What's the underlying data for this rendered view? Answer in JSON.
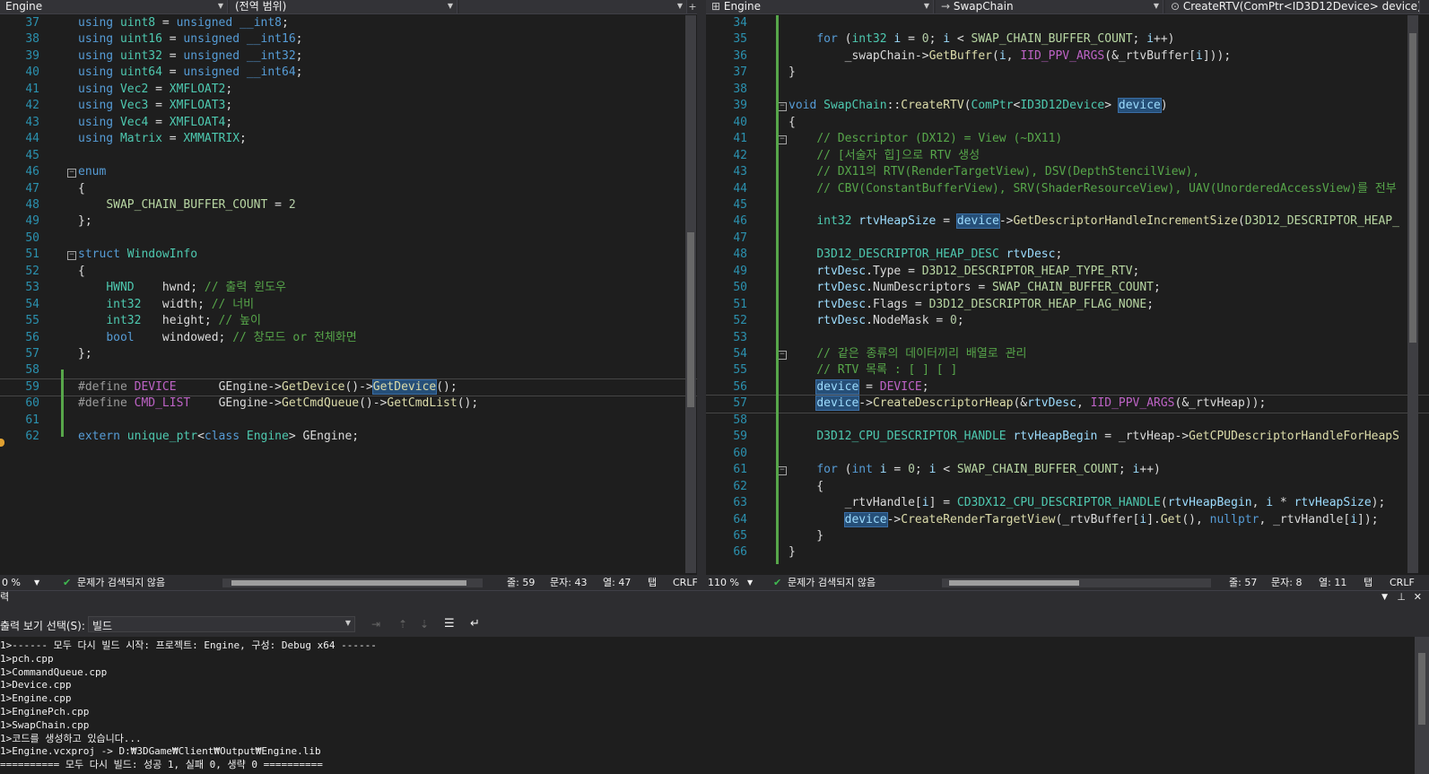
{
  "left_editor": {
    "nav": {
      "project": "Engine",
      "scope": "(전역 범위)",
      "member": ""
    },
    "status": {
      "zoom": "0 %",
      "issues": "문제가 검색되지 않음",
      "line": "줄: 59",
      "char": "문자: 43",
      "col": "열: 47",
      "tab": "탭",
      "eol": "CRLF"
    },
    "lines": [
      {
        "n": "37",
        "html": "<span class='kw'>using</span> <span class='ty'>uint8</span> = <span class='kw'>unsigned</span> <span class='kw'>__int8</span>;"
      },
      {
        "n": "38",
        "html": "<span class='kw'>using</span> <span class='ty'>uint16</span> = <span class='kw'>unsigned</span> <span class='kw'>__int16</span>;"
      },
      {
        "n": "39",
        "html": "<span class='kw'>using</span> <span class='ty'>uint32</span> = <span class='kw'>unsigned</span> <span class='kw'>__int32</span>;"
      },
      {
        "n": "40",
        "html": "<span class='kw'>using</span> <span class='ty'>uint64</span> = <span class='kw'>unsigned</span> <span class='kw'>__int64</span>;"
      },
      {
        "n": "41",
        "html": "<span class='kw'>using</span> <span class='ty'>Vec2</span> = <span class='ty'>XMFLOAT2</span>;"
      },
      {
        "n": "42",
        "html": "<span class='kw'>using</span> <span class='ty'>Vec3</span> = <span class='ty'>XMFLOAT3</span>;"
      },
      {
        "n": "43",
        "html": "<span class='kw'>using</span> <span class='ty'>Vec4</span> = <span class='ty'>XMFLOAT4</span>;"
      },
      {
        "n": "44",
        "html": "<span class='kw'>using</span> <span class='ty'>Matrix</span> = <span class='ty'>XMMATRIX</span>;"
      },
      {
        "n": "45",
        "html": ""
      },
      {
        "n": "46",
        "html": "<span class='kw'>enum</span>"
      },
      {
        "n": "47",
        "html": "{"
      },
      {
        "n": "48",
        "html": "    <span class='en'>SWAP_CHAIN_BUFFER_COUNT</span> = <span class='nm'>2</span>"
      },
      {
        "n": "49",
        "html": "};"
      },
      {
        "n": "50",
        "html": ""
      },
      {
        "n": "51",
        "html": "<span class='kw'>struct</span> <span class='ty'>WindowInfo</span>"
      },
      {
        "n": "52",
        "html": "{"
      },
      {
        "n": "53",
        "html": "    <span class='ty'>HWND</span>    hwnd; <span class='cm'>// 출력 윈도우</span>"
      },
      {
        "n": "54",
        "html": "    <span class='ty'>int32</span>   width; <span class='cm'>// 너비</span>"
      },
      {
        "n": "55",
        "html": "    <span class='ty'>int32</span>   height; <span class='cm'>// 높이</span>"
      },
      {
        "n": "56",
        "html": "    <span class='kw'>bool</span>    windowed; <span class='cm'>// 창모드 or 전체화면</span>"
      },
      {
        "n": "57",
        "html": "};"
      },
      {
        "n": "58",
        "html": ""
      },
      {
        "n": "59",
        "html": "<span class='pp'>#define</span> <span class='mc'>DEVICE</span>      <span class='mem'>GEngine</span>-><span class='fn'>GetDevice</span>()-><span class='fn hl'>GetDevice</span>();"
      },
      {
        "n": "60",
        "html": "<span class='pp'>#define</span> <span class='mc'>CMD_LIST</span>    <span class='mem'>GEngine</span>-><span class='fn'>GetCmdQueue</span>()-><span class='fn'>GetCmdList</span>();"
      },
      {
        "n": "61",
        "html": ""
      },
      {
        "n": "62",
        "html": "<span class='kw'>extern</span> <span class='ty'>unique_ptr</span>&lt;<span class='kw'>class</span> <span class='ty'>Engine</span>&gt; <span class='mem'>GEngine</span>;"
      }
    ]
  },
  "right_editor": {
    "nav": {
      "project": "Engine",
      "scope": "SwapChain",
      "member": "CreateRTV(ComPtr<ID3D12Device> device)"
    },
    "status": {
      "zoom": "110 %",
      "issues": "문제가 검색되지 않음",
      "line": "줄: 57",
      "char": "문자: 8",
      "col": "열: 11",
      "tab": "탭",
      "eol": "CRLF"
    },
    "lines": [
      {
        "n": "34",
        "html": ""
      },
      {
        "n": "35",
        "html": "    <span class='kw'>for</span> (<span class='ty'>int32</span> <span class='var'>i</span> = <span class='nm'>0</span>; <span class='var'>i</span> &lt; <span class='en'>SWAP_CHAIN_BUFFER_COUNT</span>; <span class='var'>i</span>++)"
      },
      {
        "n": "36",
        "html": "        <span class='mem'>_swapChain</span>-><span class='fn'>GetBuffer</span>(<span class='var'>i</span>, <span class='mc'>IID_PPV_ARGS</span>(&amp;<span class='mem'>_rtvBuffer</span>[<span class='var'>i</span>]));"
      },
      {
        "n": "37",
        "html": "}"
      },
      {
        "n": "38",
        "html": ""
      },
      {
        "n": "39",
        "html": "<span class='kw'>void</span> <span class='ty'>SwapChain</span>::<span class='fn'>CreateRTV</span>(<span class='ty'>ComPtr</span>&lt;<span class='ty'>ID3D12Device</span>&gt; <span class='var hl'>device</span>)"
      },
      {
        "n": "40",
        "html": "{"
      },
      {
        "n": "41",
        "html": "    <span class='cm'>// Descriptor (DX12) = View (~DX11)</span>"
      },
      {
        "n": "42",
        "html": "    <span class='cm'>// [서술자 힙]으로 RTV 생성</span>"
      },
      {
        "n": "43",
        "html": "    <span class='cm'>// DX11의 RTV(RenderTargetView), DSV(DepthStencilView),</span>"
      },
      {
        "n": "44",
        "html": "    <span class='cm'>// CBV(ConstantBufferView), SRV(ShaderResourceView), UAV(UnorderedAccessView)를 전부</span>"
      },
      {
        "n": "45",
        "html": ""
      },
      {
        "n": "46",
        "html": "    <span class='ty'>int32</span> <span class='var'>rtvHeapSize</span> = <span class='var hl'>device</span>-><span class='fn'>GetDescriptorHandleIncrementSize</span>(<span class='en'>D3D12_DESCRIPTOR_HEAP_</span>"
      },
      {
        "n": "47",
        "html": ""
      },
      {
        "n": "48",
        "html": "    <span class='ty'>D3D12_DESCRIPTOR_HEAP_DESC</span> <span class='var'>rtvDesc</span>;"
      },
      {
        "n": "49",
        "html": "    <span class='var'>rtvDesc</span>.<span class='mem'>Type</span> = <span class='en'>D3D12_DESCRIPTOR_HEAP_TYPE_RTV</span>;"
      },
      {
        "n": "50",
        "html": "    <span class='var'>rtvDesc</span>.<span class='mem'>NumDescriptors</span> = <span class='en'>SWAP_CHAIN_BUFFER_COUNT</span>;"
      },
      {
        "n": "51",
        "html": "    <span class='var'>rtvDesc</span>.<span class='mem'>Flags</span> = <span class='en'>D3D12_DESCRIPTOR_HEAP_FLAG_NONE</span>;"
      },
      {
        "n": "52",
        "html": "    <span class='var'>rtvDesc</span>.<span class='mem'>NodeMask</span> = <span class='nm'>0</span>;"
      },
      {
        "n": "53",
        "html": ""
      },
      {
        "n": "54",
        "html": "    <span class='cm'>// 같은 종류의 데이터끼리 배열로 관리</span>"
      },
      {
        "n": "55",
        "html": "    <span class='cm'>// RTV 목록 : [ ] [ ]</span>"
      },
      {
        "n": "56",
        "html": "    <span class='var hl'>device</span> = <span class='mc'>DEVICE</span>;"
      },
      {
        "n": "57",
        "html": "    <span class='var hl'>device</span>-><span class='fn'>CreateDescriptorHeap</span>(&amp;<span class='var'>rtvDesc</span>, <span class='mc'>IID_PPV_ARGS</span>(&amp;<span class='mem'>_rtvHeap</span>));"
      },
      {
        "n": "58",
        "html": ""
      },
      {
        "n": "59",
        "html": "    <span class='ty'>D3D12_CPU_DESCRIPTOR_HANDLE</span> <span class='var'>rtvHeapBegin</span> = <span class='mem'>_rtvHeap</span>-><span class='fn'>GetCPUDescriptorHandleForHeapS</span>"
      },
      {
        "n": "60",
        "html": ""
      },
      {
        "n": "61",
        "html": "    <span class='kw'>for</span> (<span class='kw'>int</span> <span class='var'>i</span> = <span class='nm'>0</span>; <span class='var'>i</span> &lt; <span class='en'>SWAP_CHAIN_BUFFER_COUNT</span>; <span class='var'>i</span>++)"
      },
      {
        "n": "62",
        "html": "    {"
      },
      {
        "n": "63",
        "html": "        <span class='mem'>_rtvHandle</span>[<span class='var'>i</span>] = <span class='ty'>CD3DX12_CPU_DESCRIPTOR_HANDLE</span>(<span class='var'>rtvHeapBegin</span>, <span class='var'>i</span> * <span class='var'>rtvHeapSize</span>);"
      },
      {
        "n": "64",
        "html": "        <span class='var hl'>device</span>-><span class='fn'>CreateRenderTargetView</span>(<span class='mem'>_rtvBuffer</span>[<span class='var'>i</span>].<span class='fn'>Get</span>(), <span class='kw'>nullptr</span>, <span class='mem'>_rtvHandle</span>[<span class='var'>i</span>]);"
      },
      {
        "n": "65",
        "html": "    }"
      },
      {
        "n": "66",
        "html": "}"
      }
    ]
  },
  "output": {
    "title": "력",
    "show_from_label": "출력 보기 선택(S):",
    "show_from_value": "빌드",
    "lines": [
      "1>------ 모두 다시 빌드 시작: 프로젝트: Engine, 구성: Debug x64 ------",
      "1>pch.cpp",
      "1>CommandQueue.cpp",
      "1>Device.cpp",
      "1>Engine.cpp",
      "1>EnginePch.cpp",
      "1>SwapChain.cpp",
      "1>코드를 생성하고 있습니다...",
      "1>Engine.vcxproj -> D:₩3DGame₩Client₩Output₩Engine.lib",
      "========== 모두 다시 빌드: 성공 1, 실패 0, 생략 0 =========="
    ]
  }
}
